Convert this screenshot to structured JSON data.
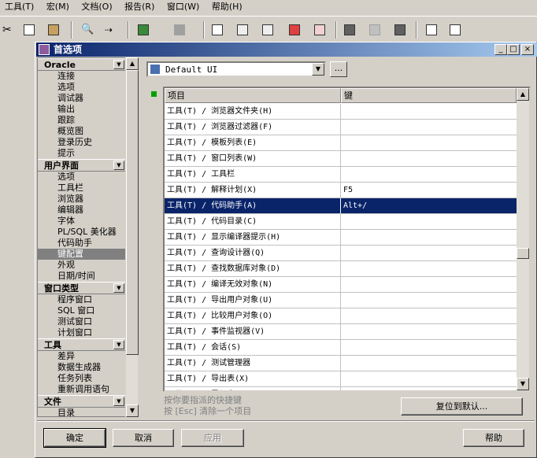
{
  "ide": {
    "menu": [
      "工具(T)",
      "宏(M)",
      "文档(O)",
      "报告(R)",
      "窗口(W)",
      "帮助(H)"
    ]
  },
  "dialog": {
    "title": "首选项",
    "controls": {
      "minimize": "_",
      "maximize": "□",
      "close": "×"
    },
    "categories": [
      {
        "group": "Oracle",
        "items": [
          "连接",
          "选项",
          "调试器",
          "输出",
          "跟踪",
          "概览图",
          "登录历史",
          "提示"
        ]
      },
      {
        "group": "用户界面",
        "items": [
          "选项",
          "工具栏",
          "浏览器",
          "编辑器",
          "字体",
          "PL/SQL 美化器",
          "代码助手",
          "键配置",
          "外观",
          "日期/时间"
        ]
      },
      {
        "group": "窗口类型",
        "items": [
          "程序窗口",
          "SQL 窗口",
          "测试窗口",
          "计划窗口"
        ]
      },
      {
        "group": "工具",
        "items": [
          "差异",
          "数据生成器",
          "任务列表",
          "重新调用语句"
        ]
      },
      {
        "group": "文件",
        "items": [
          "目录"
        ]
      }
    ],
    "selected_category": "键配置",
    "ui_selector": {
      "value": "Default UI",
      "more_label": "..."
    },
    "grid": {
      "columns": [
        "项目",
        "键"
      ],
      "rows": [
        {
          "item": "工具(T) / 浏览器文件夹(H)",
          "key": ""
        },
        {
          "item": "工具(T) / 浏览器过滤器(F)",
          "key": ""
        },
        {
          "item": "工具(T) / 模板列表(E)",
          "key": ""
        },
        {
          "item": "工具(T) / 窗口列表(W)",
          "key": ""
        },
        {
          "item": "工具(T) / 工具栏",
          "key": ""
        },
        {
          "item": "工具(T) / 解释计划(X)",
          "key": "F5"
        },
        {
          "item": "工具(T) / 代码助手(A)",
          "key": "Alt+/",
          "selected": true
        },
        {
          "item": "工具(T) / 代码目录(C)",
          "key": ""
        },
        {
          "item": "工具(T) / 显示编译器提示(H)",
          "key": ""
        },
        {
          "item": "工具(T) / 查询设计器(Q)",
          "key": ""
        },
        {
          "item": "工具(T) / 查找数据库对象(D)",
          "key": ""
        },
        {
          "item": "工具(T) / 编译无效对象(N)",
          "key": ""
        },
        {
          "item": "工具(T) / 导出用户对象(U)",
          "key": ""
        },
        {
          "item": "工具(T) / 比较用户对象(O)",
          "key": ""
        },
        {
          "item": "工具(T) / 事件监视器(V)",
          "key": ""
        },
        {
          "item": "工具(T) / 会话(S)",
          "key": ""
        },
        {
          "item": "工具(T) / 测试管理器",
          "key": ""
        },
        {
          "item": "工具(T) / 导出表(X)",
          "key": ""
        },
        {
          "item": "工具(T) / 导入表(I)",
          "key": ""
        }
      ]
    },
    "hint_line1": "按你要指派的快捷键",
    "hint_line2": "按 [Esc] 清除一个项目",
    "reset_button": "复位到默认...",
    "buttons": {
      "ok": "确定",
      "cancel": "取消",
      "apply": "应用",
      "help": "帮助"
    }
  }
}
